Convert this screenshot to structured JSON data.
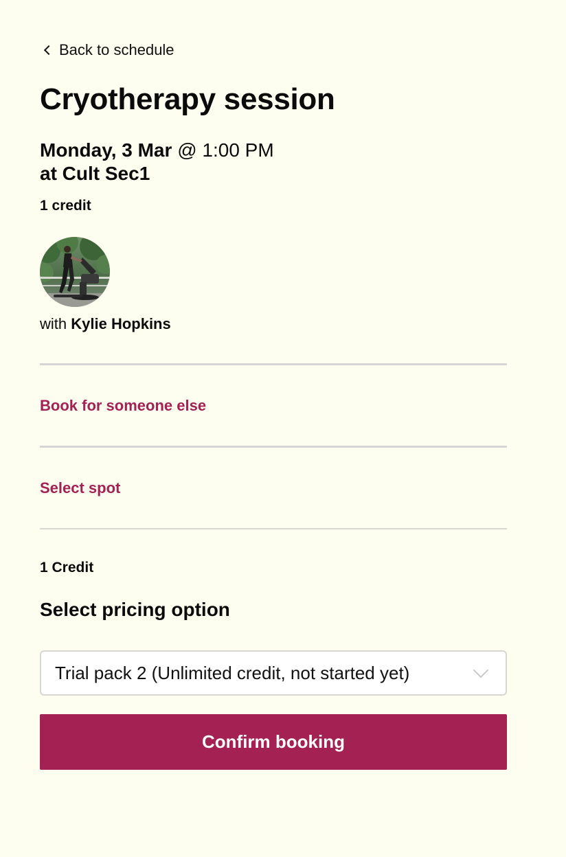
{
  "nav": {
    "back_label": "Back to schedule"
  },
  "session": {
    "title": "Cryotherapy session",
    "date": "Monday, 3 Mar",
    "at_time": "@ 1:00 PM",
    "location": "at Cult Sec1",
    "credit": "1 credit"
  },
  "instructor": {
    "prefix": "with",
    "name": "Kylie Hopkins"
  },
  "options": {
    "book_for_someone": "Book for someone else",
    "select_spot": "Select spot"
  },
  "pricing": {
    "credit_label": "1 Credit",
    "heading": "Select pricing option",
    "selected": "Trial pack 2 (Unlimited credit, not started yet)"
  },
  "actions": {
    "confirm_label": "Confirm booking"
  },
  "colors": {
    "background": "#fefef0",
    "accent": "#a32153",
    "text": "#0b0b0b",
    "divider": "#d6d6d4"
  },
  "icons": {
    "back": "chevron-left-icon",
    "select": "chevron-down-icon"
  }
}
